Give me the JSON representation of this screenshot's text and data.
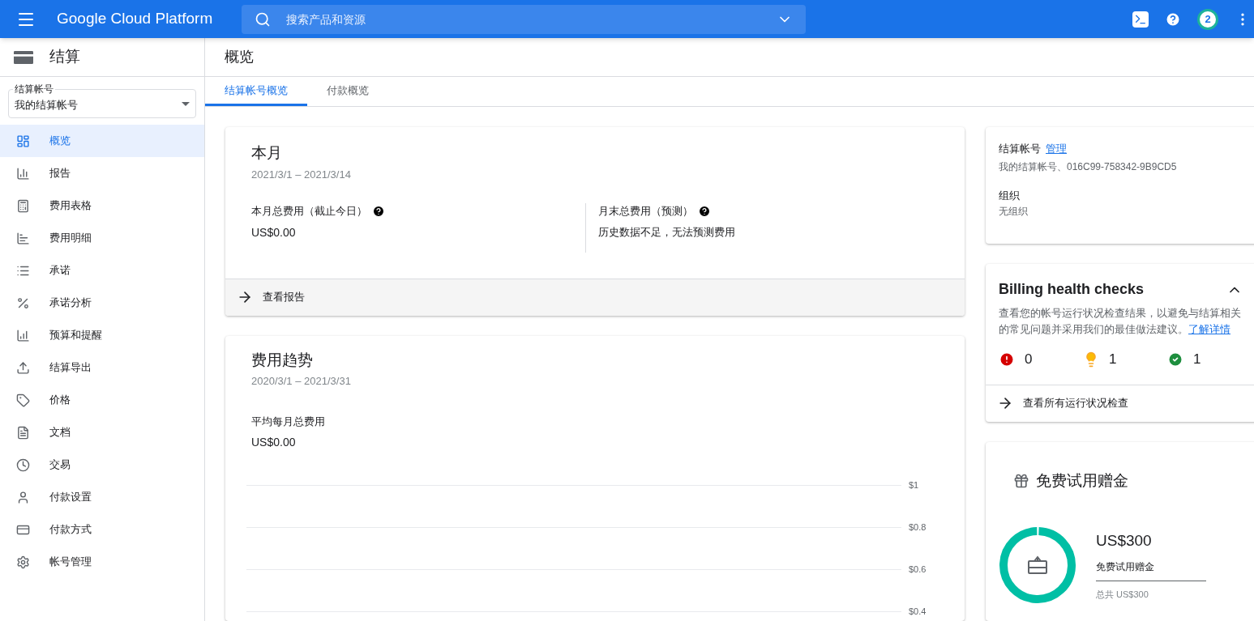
{
  "top_bar": {
    "title": "Google Cloud Platform",
    "search": {
      "placeholder": "搜索产品和资源"
    },
    "notification_count": "2"
  },
  "sidebar": {
    "title": "结算",
    "account_select": {
      "label": "结算帐号",
      "value": "我的结算帐号"
    },
    "items": [
      {
        "label": "概览",
        "selected": true
      },
      {
        "label": "报告",
        "selected": false
      },
      {
        "label": "费用表格",
        "selected": false
      },
      {
        "label": "费用明细",
        "selected": false
      },
      {
        "label": "承诺",
        "selected": false
      },
      {
        "label": "承诺分析",
        "selected": false
      },
      {
        "label": "预算和提醒",
        "selected": false
      },
      {
        "label": "结算导出",
        "selected": false
      },
      {
        "label": "价格",
        "selected": false
      },
      {
        "label": "文档",
        "selected": false
      },
      {
        "label": "交易",
        "selected": false
      },
      {
        "label": "付款设置",
        "selected": false
      },
      {
        "label": "付款方式",
        "selected": false
      },
      {
        "label": "帐号管理",
        "selected": false
      }
    ]
  },
  "page": {
    "title": "概览",
    "tabs": [
      {
        "label": "结算帐号概览",
        "selected": true
      },
      {
        "label": "付款概览",
        "selected": false
      }
    ]
  },
  "this_month": {
    "title": "本月",
    "date_range": "2021/3/1 – 2021/3/14",
    "cost_label": "本月总费用（截止今日）",
    "cost_value": "US$0.00",
    "forecast_label": "月末总费用（预测）",
    "forecast_value": "历史数据不足，无法预测费用",
    "action": "查看报告"
  },
  "cost_trend": {
    "title": "费用趋势",
    "date_range": "2020/3/1 – 2021/3/31",
    "avg_label": "平均每月总费用",
    "avg_value": "US$0.00",
    "axis_labels": [
      "$1",
      "$0.8",
      "$0.6",
      "$0.4"
    ]
  },
  "account_info": {
    "account_label": "结算帐号",
    "manage_link": "管理",
    "account_value": "我的结算帐号、016C99-758342-9B9CD5",
    "org_label": "组织",
    "org_value": "无组织"
  },
  "health_checks": {
    "title": "Billing health checks",
    "expanded": true,
    "description": "查看您的帐号运行状况检查结果，以避免与结算相关的常见问题并采用我们的最佳做法建议。",
    "learn_more": "了解详情",
    "counts": [
      {
        "kind": "error",
        "count": "0"
      },
      {
        "kind": "warning",
        "count": "1"
      },
      {
        "kind": "ok",
        "count": "1"
      }
    ],
    "action": "查看所有运行状况检查"
  },
  "free_trial": {
    "title": "免费试用赠金",
    "amount": "US$300",
    "amount_label": "免费试用赠金",
    "total": "总共 US$300",
    "level": 0.99
  }
}
